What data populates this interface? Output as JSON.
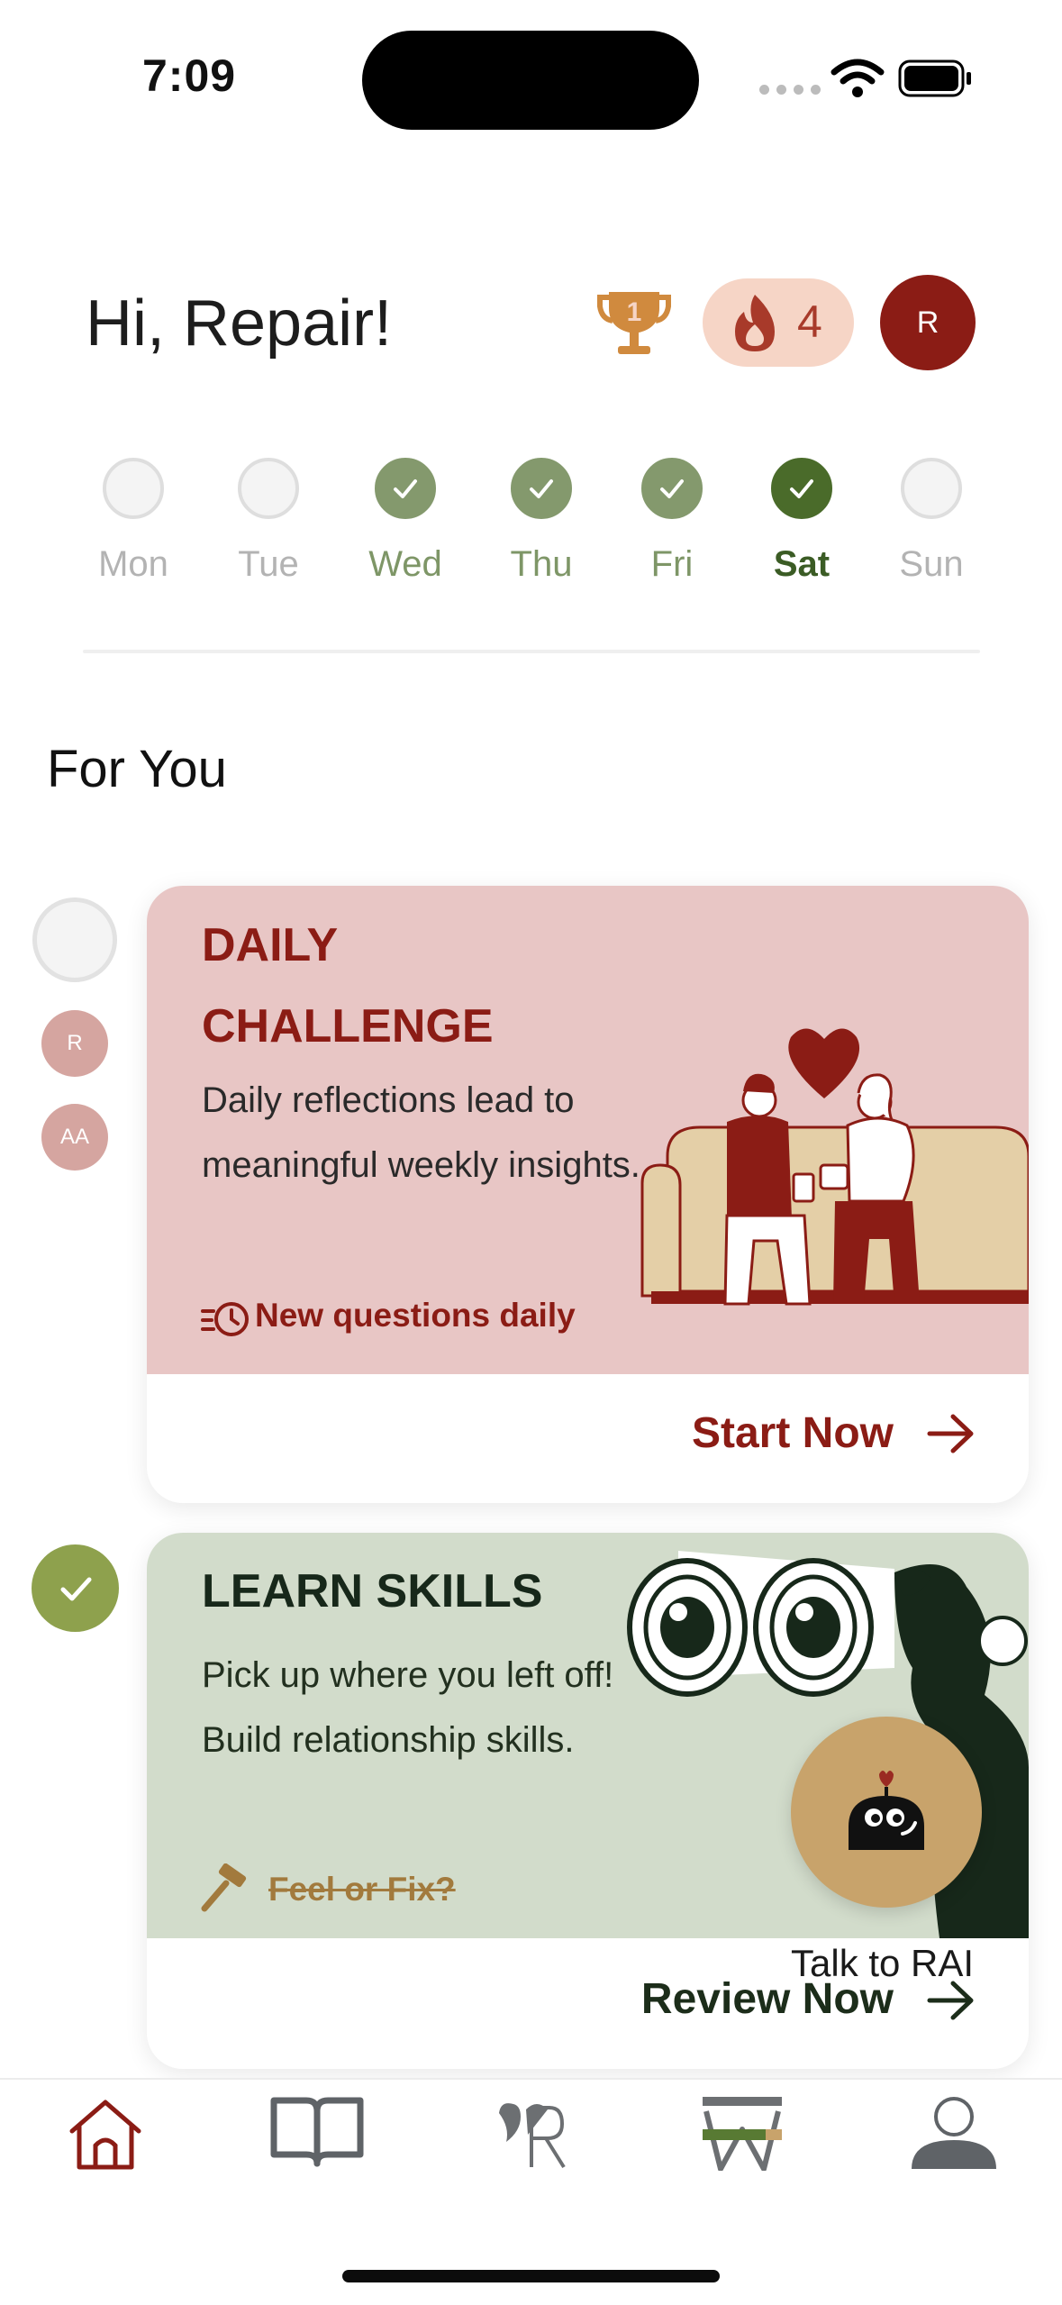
{
  "status_bar": {
    "time": "7:09"
  },
  "header": {
    "greeting": "Hi, Repair!",
    "trophy_icon": "trophy-icon",
    "streak": {
      "count": "4",
      "icon": "flame-icon",
      "color": "#a83a2a"
    },
    "avatar_initial": "R",
    "avatar_color": "#8b1c15"
  },
  "week": [
    {
      "label": "Mon",
      "state": "empty"
    },
    {
      "label": "Tue",
      "state": "empty"
    },
    {
      "label": "Wed",
      "state": "done"
    },
    {
      "label": "Thu",
      "state": "done"
    },
    {
      "label": "Fri",
      "state": "done"
    },
    {
      "label": "Sat",
      "state": "today"
    },
    {
      "label": "Sun",
      "state": "empty"
    }
  ],
  "section_title": "For You",
  "timeline": {
    "participants": [
      "R",
      "AA"
    ]
  },
  "daily_challenge": {
    "title": "DAILY CHALLENGE",
    "description": "Daily reflections lead to meaningful weekly insights.",
    "meta": "New questions daily",
    "cta": "Start Now",
    "accent": "#8b1c15",
    "background": "#e8c6c5"
  },
  "learn_skills": {
    "title": "LEARN SKILLS",
    "description": "Pick up where you left off! Build relationship skills.",
    "meta": "Feel or Fix?",
    "cta": "Review Now",
    "background": "#d2dccb"
  },
  "assistant": {
    "label": "Talk to RAI",
    "icon": "robot-heart-icon"
  },
  "tabs": [
    {
      "name": "home",
      "icon": "home-icon",
      "active": true
    },
    {
      "name": "journal",
      "icon": "book-icon",
      "active": false
    },
    {
      "name": "repair",
      "icon": "repair-logo-icon",
      "active": false
    },
    {
      "name": "workshop",
      "icon": "w-logo-icon",
      "active": false
    },
    {
      "name": "profile",
      "icon": "profile-icon",
      "active": false
    }
  ]
}
